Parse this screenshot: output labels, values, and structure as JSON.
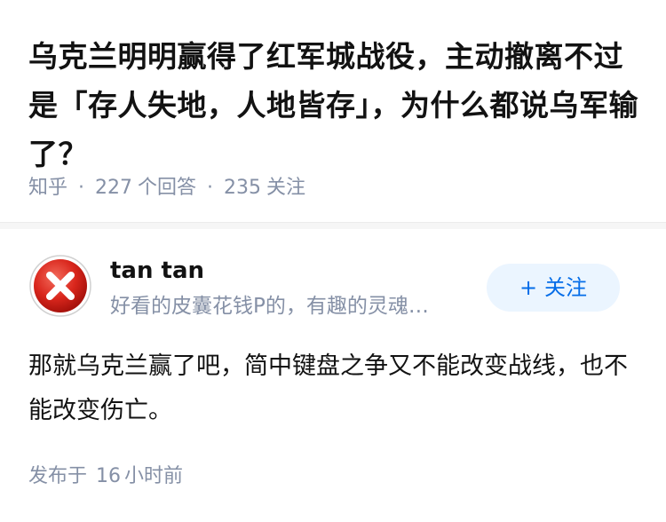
{
  "question": {
    "title": "乌克兰明明赢得了红军城战役，主动撤离不过是「存人失地，人地皆存」，为什么都说乌军输了？",
    "source": "知乎",
    "separator": "·",
    "answers_count": "227",
    "answers_label": "个回答",
    "followers_count": "235",
    "followers_label": "关注"
  },
  "answer": {
    "author": {
      "name": "tan tan",
      "bio": "好看的皮囊花钱P的，有趣的灵魂…",
      "avatar_icon": "error-x-icon"
    },
    "follow_button": {
      "plus": "+",
      "label": "关注"
    },
    "content": "那就乌克兰赢了吧，简中键盘之争又不能改变战线，也不能改变伤亡。",
    "time": {
      "prefix": "发布于",
      "value": "16",
      "suffix": "小时前"
    }
  },
  "colors": {
    "accent": "#056de8",
    "follow_bg": "#ebf5ff",
    "meta_gray": "#8590a6",
    "avatar_red": "#d9261c"
  }
}
